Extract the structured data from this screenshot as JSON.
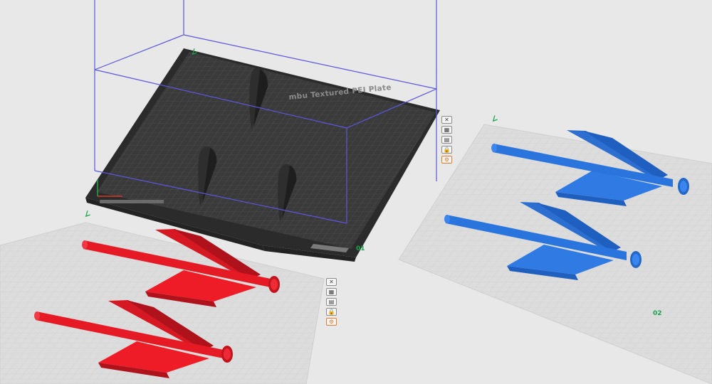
{
  "plates": [
    {
      "id": "plate-1",
      "number": "01",
      "name": "mbu Textured PEI Plate",
      "active": true,
      "parts_color": "#2b2b2b",
      "part_count": 3
    },
    {
      "id": "plate-2",
      "number": "02",
      "active": false,
      "parts_color": "#1e6fd6",
      "part_count": 2
    },
    {
      "id": "plate-3",
      "active": false,
      "parts_color": "#e3121f",
      "part_count": 2
    }
  ],
  "plate_toolbar": {
    "icons": [
      "close-plate-icon",
      "arrange-icon",
      "orient-icon",
      "lock-icon",
      "settings-icon"
    ],
    "glyphs": [
      "✕",
      "▦",
      "▤",
      "🔒",
      "⚙"
    ]
  },
  "corner_glyph": "∠",
  "colors": {
    "background": "#e8e8e8",
    "grid_plate": "#d9d9d9",
    "bed": "#3a3a3a",
    "bounding_box": "#5a57e0",
    "accent_green": "#1aa34a",
    "toolbar_orange": "#e87a2a"
  }
}
